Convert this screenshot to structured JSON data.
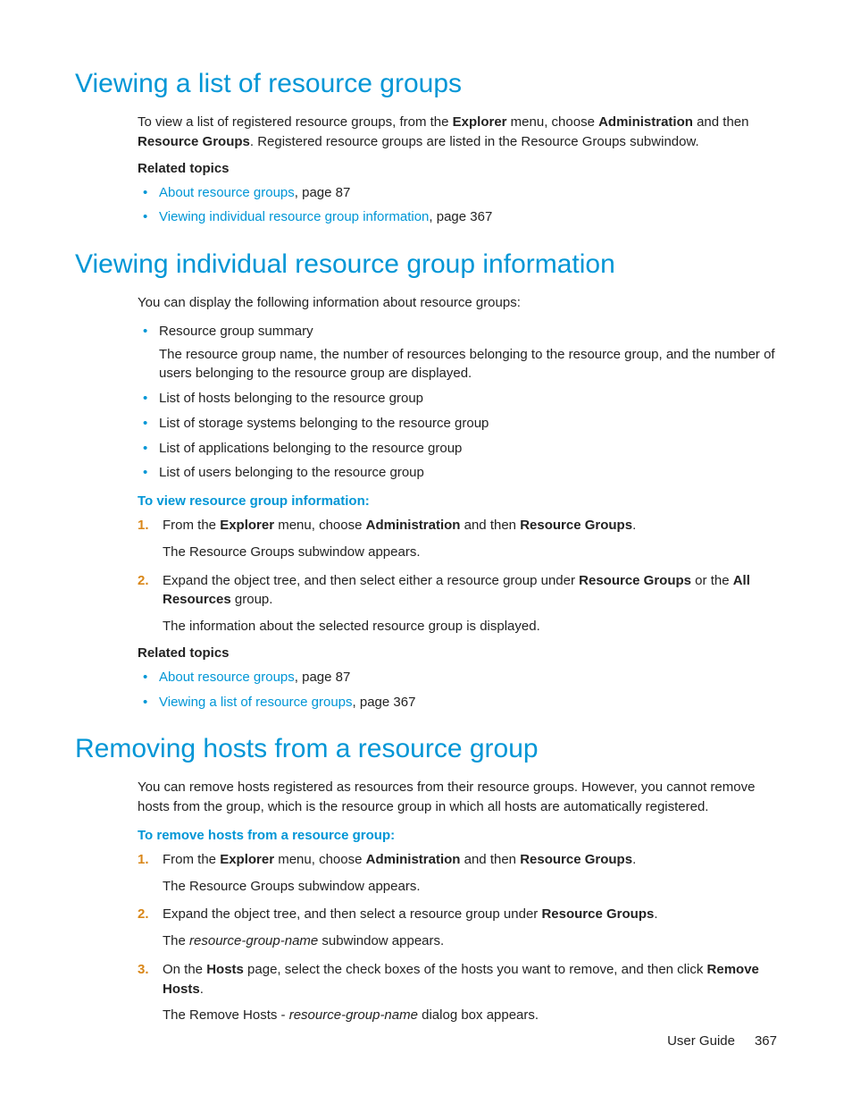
{
  "section1": {
    "heading": "Viewing a list of resource groups",
    "intro_parts": {
      "t1": "To view a list of registered resource groups, from the ",
      "b1": "Explorer",
      "t2": " menu, choose ",
      "b2": "Administration",
      "t3": " and then ",
      "b3": "Resource Groups",
      "t4": ". Registered resource groups are listed in the Resource Groups subwindow."
    },
    "related_label": "Related topics",
    "related": [
      {
        "link": "About resource groups",
        "tail": ", page 87"
      },
      {
        "link": "Viewing individual resource group information",
        "tail": ", page 367"
      }
    ]
  },
  "section2": {
    "heading": "Viewing individual resource group information",
    "intro": "You can display the following information about resource groups:",
    "bullets": [
      {
        "text": "Resource group summary",
        "detail": "The resource group name, the number of resources belonging to the resource group, and the number of users belonging to the resource group are displayed."
      },
      {
        "text": "List of hosts belonging to the resource group"
      },
      {
        "text": "List of storage systems belonging to the resource group"
      },
      {
        "text": "List of applications belonging to the resource group"
      },
      {
        "text": "List of users belonging to the resource group"
      }
    ],
    "procedure_label": "To view resource group information:",
    "steps": {
      "s1": {
        "t1": "From the ",
        "b1": "Explorer",
        "t2": " menu, choose ",
        "b2": "Administration",
        "t3": " and then ",
        "b3": "Resource Groups",
        "t4": ".",
        "result": "The Resource Groups subwindow appears."
      },
      "s2": {
        "t1": "Expand the object tree, and then select either a resource group under ",
        "b1": "Resource Groups",
        "t2": " or the ",
        "b2": "All Resources",
        "t3": " group.",
        "result": "The information about the selected resource group is displayed."
      }
    },
    "related_label": "Related topics",
    "related": [
      {
        "link": "About resource groups",
        "tail": ", page 87"
      },
      {
        "link": "Viewing a list of resource groups",
        "tail": ", page 367"
      }
    ]
  },
  "section3": {
    "heading": "Removing hosts from a resource group",
    "intro": "You can remove hosts registered as resources from their resource groups. However, you cannot remove hosts from the                              group, which is the resource group in which all hosts are automatically registered.",
    "procedure_label": "To remove hosts from a resource group:",
    "steps": {
      "s1": {
        "t1": "From the ",
        "b1": "Explorer",
        "t2": " menu, choose ",
        "b2": "Administration",
        "t3": " and then ",
        "b3": "Resource Groups",
        "t4": ".",
        "result": "The Resource Groups subwindow appears."
      },
      "s2": {
        "t1": "Expand the object tree, and then select a resource group under ",
        "b1": "Resource Groups",
        "t2": ".",
        "result_pre": "The ",
        "result_it": "resource-group-name",
        "result_post": " subwindow appears."
      },
      "s3": {
        "t1": "On the ",
        "b1": "Hosts",
        "t2": " page, select the check boxes of the hosts you want to remove, and then click ",
        "b2": "Remove Hosts",
        "t3": ".",
        "result_pre": "The Remove Hosts - ",
        "result_it": "resource-group-name",
        "result_post": " dialog box appears."
      }
    }
  },
  "footer": {
    "label": "User Guide",
    "page": "367"
  }
}
